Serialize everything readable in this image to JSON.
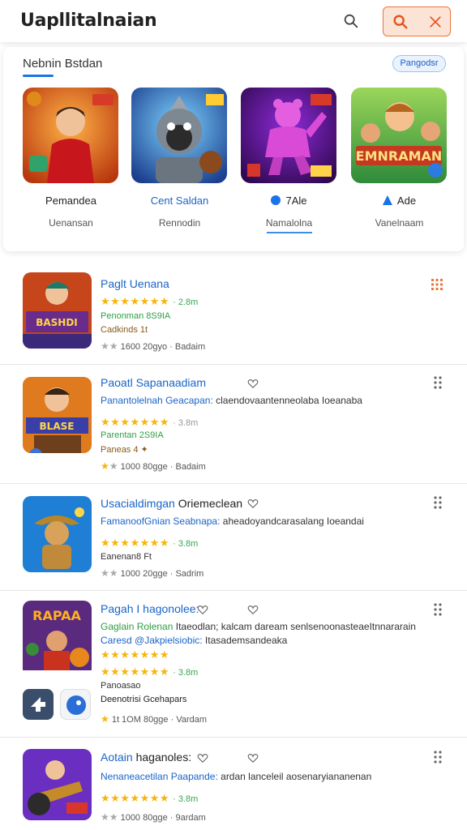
{
  "header": {
    "title": "Uapllitalnaian"
  },
  "featured": {
    "title": "Nebnin Bstdan",
    "pill": "Pangodsr",
    "items": [
      {
        "name": "Pemandea",
        "sub": "Uenansan"
      },
      {
        "name": "Cent Saldan",
        "sub": "Rennodin"
      },
      {
        "name": "7Ale",
        "sub": "Namalolna"
      },
      {
        "name": "Ade",
        "sub": "Vanelnaam"
      }
    ]
  },
  "list": [
    {
      "title": "Paglt Uenana",
      "stars_text": "★★★★★★★",
      "rating": "· 2.8m",
      "line1": "Penonman 8S9IA",
      "line2": "Cadkinds 1t",
      "meta": "1600 20gyo · Badaim"
    },
    {
      "title": "Paoatl Sapanaadiam",
      "desc_link": "Panantolelnah Geacapan:",
      "desc_plain": "claendovaantenneolaba Ioeanaba",
      "stars_text": "★★★★★★★",
      "rating": "· 3.8m",
      "line1": "Parentan 2S9IA",
      "line2": "Paneas 4 ✦",
      "meta": "1000 80gge · Badaim"
    },
    {
      "title": "Usacialdimgan",
      "title_plain": "Oriemeclean",
      "desc_link": "FamanoofGnian Seabnapa:",
      "desc_plain": "aheadoyandcarasalang Ioeandai",
      "stars_text": "★★★★★★★",
      "rating": "· 3.8m",
      "line1": "Eanenan8 Ft",
      "meta": "1000 20gge · Sadrim"
    },
    {
      "title": "Pagah I hagonolee:",
      "desc_link": "Gaglain Rolenan",
      "desc_plain": "Itaeodlan; kalcam daream senlsenoonasteaeItnnararain",
      "desc2_link": "Caresd @Jakpielsiobic:",
      "desc2_plain": "Itasademsandeaka",
      "stars_text": "★★★★★★★",
      "rating": "· 3.8m",
      "line1": "Panoasao",
      "line2": "Deenotrisi Gcehapars",
      "meta": "1t 1OM 80gge · Vardam"
    },
    {
      "title": "Aotain",
      "title_plain": "haganoles:",
      "desc_link": "Nenaneacetilan Paapande:",
      "desc_plain": "ardan lanceleil aosenaryiananenan",
      "stars_text": "★★★★★★★",
      "rating": "· 3.8m",
      "meta": "1000 80gge · 9ardam"
    }
  ],
  "colors": {
    "accent": "#1a73e8",
    "orange": "#e9773d",
    "star": "#f5b50a",
    "green": "#34a853"
  }
}
